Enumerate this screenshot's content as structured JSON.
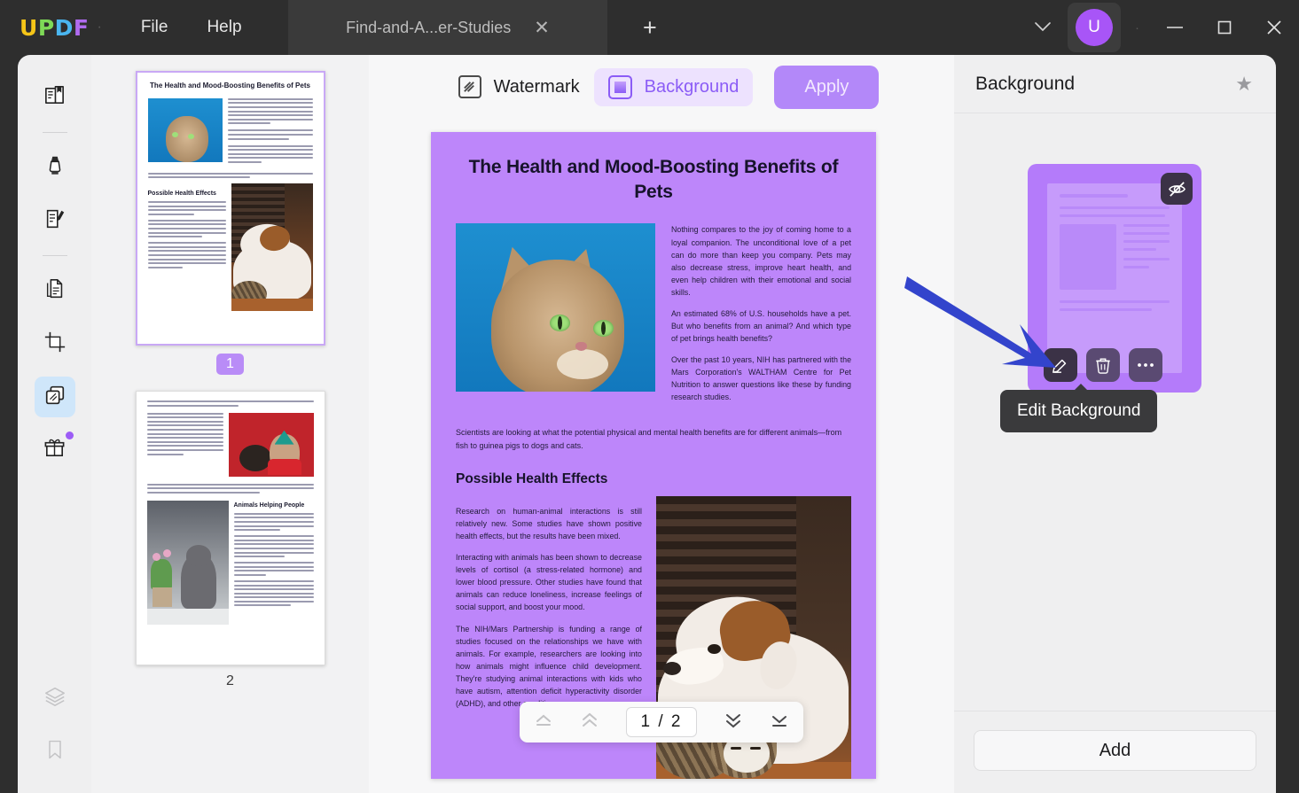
{
  "app": {
    "name": "UPDF",
    "logo_letters": [
      "U",
      "P",
      "D",
      "F"
    ],
    "menus": [
      {
        "label": "File",
        "name": "menu-file"
      },
      {
        "label": "Help",
        "name": "menu-help"
      }
    ],
    "tab": {
      "label": "Find-and-A...er-Studies",
      "close_icon": "close-icon",
      "new_tab_icon": "plus-icon"
    },
    "window": {
      "chevron_icon": "chevron-down-icon",
      "avatar_letter": "U",
      "minimize_icon": "minimize-icon",
      "maximize_icon": "maximize-icon",
      "close_icon": "close-icon"
    }
  },
  "sidebar": {
    "items": [
      {
        "name": "sidebar-item-reader",
        "icon": "book-reader-icon"
      },
      {
        "name": "sidebar-item-annotate",
        "icon": "highlighter-marker-icon"
      },
      {
        "name": "sidebar-item-edit-pdf",
        "icon": "edit-document-icon"
      },
      {
        "name": "sidebar-item-organize-pages",
        "icon": "pages-stack-icon"
      },
      {
        "name": "sidebar-item-crop",
        "icon": "crop-icon"
      },
      {
        "name": "sidebar-item-page-tools",
        "icon": "layered-pages-icon",
        "selected": true
      },
      {
        "name": "sidebar-item-gift",
        "icon": "gift-icon",
        "badge": true
      }
    ],
    "bottom_items": [
      {
        "name": "sidebar-item-layers",
        "icon": "layers-icon"
      },
      {
        "name": "sidebar-item-bookmarks",
        "icon": "bookmark-icon"
      }
    ]
  },
  "thumbnails": {
    "pages": [
      {
        "number": "1",
        "selected": true,
        "title": "The Health and Mood-Boosting Benefits of Pets",
        "heading": "Possible Health Effects"
      },
      {
        "number": "2",
        "selected": false,
        "heading": "Animals Helping People"
      }
    ]
  },
  "toolbar": {
    "watermark_label": "Watermark",
    "watermark_icon": "watermark-icon",
    "background_label": "Background",
    "background_icon": "background-icon",
    "apply_label": "Apply"
  },
  "document": {
    "title": "The Health and Mood-Boosting Benefits of Pets",
    "intro_paragraphs": [
      "Nothing compares to the joy of coming home to a loyal companion. The unconditional love of a pet can do more than keep you company. Pets may also decrease stress, improve heart health, and even help children with their emotional and social skills.",
      "An estimated 68% of U.S. households have a pet. But who benefits from an animal? And which type of pet brings health benefits?",
      "Over the past 10 years, NIH has partnered with the Mars Corporation's WALTHAM Centre for Pet Nutrition to answer questions like these by funding research studies."
    ],
    "wide_paragraph": "Scientists are looking at what the potential physical and mental health benefits are for different animals—from fish to guinea pigs to dogs and cats.",
    "section_heading": "Possible Health Effects",
    "section_paragraphs": [
      "Research on human-animal interactions is still relatively new. Some studies have shown positive health effects, but the results have been mixed.",
      "Interacting with animals has been shown to decrease levels of cortisol (a stress-related hormone) and lower blood pressure. Other studies have found that animals can reduce loneliness, increase feelings of social support, and boost your mood.",
      "The NIH/Mars Partnership is funding a range of studies focused on the relationships we have with animals. For example, researchers are looking into how animals might influence child development. They're studying animal interactions with kids who have autism, attention deficit hyperactivity disorder (ADHD), and other conditions."
    ],
    "background_color": "#bd86fa"
  },
  "page_nav": {
    "first_icon": "first-page-icon",
    "prev_icon": "previous-page-icon",
    "value": "1 / 2",
    "next_icon": "next-page-icon",
    "last_icon": "last-page-icon"
  },
  "right_panel": {
    "title": "Background",
    "star_icon": "star-icon",
    "card": {
      "hide_icon": "eye-off-icon",
      "edit_icon": "pencil-edit-icon",
      "delete_icon": "trash-delete-icon",
      "more_icon": "more-ellipsis-icon"
    },
    "tooltip": "Edit Background",
    "add_label": "Add"
  },
  "annotation": {
    "arrow_color": "#3344cc",
    "name": "pointer-arrow"
  }
}
